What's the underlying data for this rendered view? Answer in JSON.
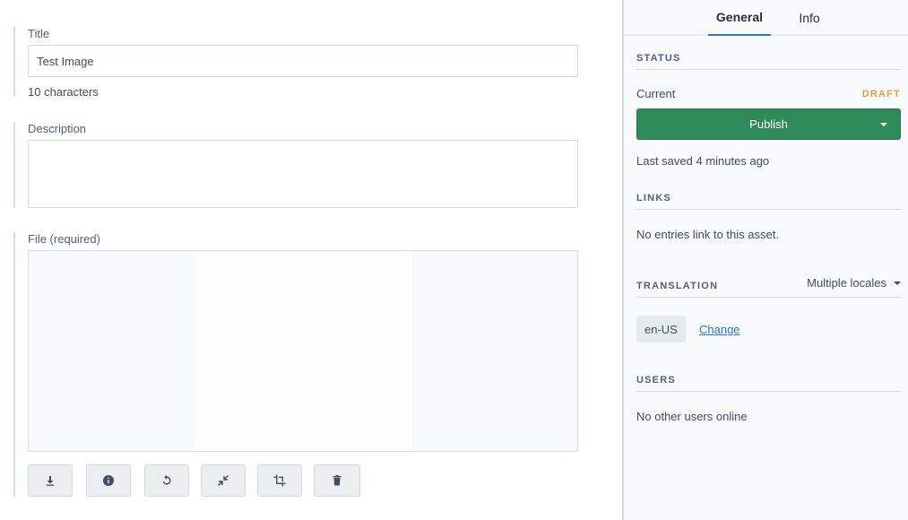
{
  "fields": {
    "title": {
      "label": "Title",
      "value": "Test Image",
      "help": "10 characters"
    },
    "description": {
      "label": "Description",
      "value": ""
    },
    "file": {
      "label": "File (required)"
    }
  },
  "file_toolbar": {
    "buttons": [
      {
        "icon": "download-icon"
      },
      {
        "icon": "info-icon"
      },
      {
        "icon": "rotate-icon"
      },
      {
        "icon": "shrink-icon"
      },
      {
        "icon": "crop-icon"
      },
      {
        "icon": "trash-icon"
      }
    ]
  },
  "sidebar": {
    "tabs": [
      {
        "label": "General",
        "active": true
      },
      {
        "label": "Info",
        "active": false
      }
    ],
    "status": {
      "heading": "STATUS",
      "current_label": "Current",
      "badge": "DRAFT",
      "publish_label": "Publish",
      "last_saved": "Last saved 4 minutes ago"
    },
    "links": {
      "heading": "LINKS",
      "text": "No entries link to this asset."
    },
    "translation": {
      "heading": "TRANSLATION",
      "dropdown_label": "Multiple locales",
      "locale": "en-US",
      "change_label": "Change"
    },
    "users": {
      "heading": "USERS",
      "text": "No other users online"
    }
  },
  "colors": {
    "publish": "#2f8c5a",
    "draft": "#e8a03a",
    "tab_active": "#2e75d4",
    "link": "#2e75d4"
  }
}
